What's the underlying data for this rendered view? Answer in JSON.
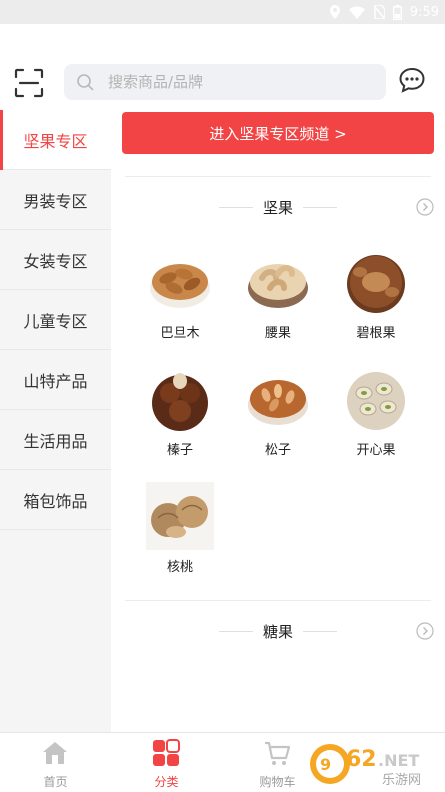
{
  "status_bar": {
    "time": "9:59",
    "icons": [
      "location-icon",
      "wifi-icon",
      "no-sim-icon",
      "battery-icon"
    ]
  },
  "header": {
    "search_placeholder": "搜索商品/品牌",
    "left_icon": "scan-icon",
    "right_icon": "message-icon"
  },
  "sidebar": {
    "items": [
      {
        "label": "坚果专区",
        "active": true
      },
      {
        "label": "男装专区",
        "active": false
      },
      {
        "label": "女装专区",
        "active": false
      },
      {
        "label": "儿童专区",
        "active": false
      },
      {
        "label": "山特产品",
        "active": false
      },
      {
        "label": "生活用品",
        "active": false
      },
      {
        "label": "箱包饰品",
        "active": false
      }
    ]
  },
  "main": {
    "banner": "进入坚果专区频道 >",
    "sections": [
      {
        "title": "坚果",
        "products": [
          "巴旦木",
          "腰果",
          "碧根果",
          "榛子",
          "松子",
          "开心果",
          "核桃"
        ]
      },
      {
        "title": "糖果",
        "products": []
      }
    ]
  },
  "tabbar": {
    "tabs": [
      {
        "label": "首页",
        "icon": "home-icon",
        "active": false
      },
      {
        "label": "分类",
        "icon": "category-icon",
        "active": true
      },
      {
        "label": "购物车",
        "icon": "cart-icon",
        "active": false
      }
    ]
  },
  "watermark": {
    "text": "962.NET",
    "sub": "乐游网"
  },
  "colors": {
    "accent": "#f24444",
    "sidebar_bg": "#f5f5f5",
    "search_bg": "#f0f1f4",
    "status_bar": "#ececec"
  }
}
